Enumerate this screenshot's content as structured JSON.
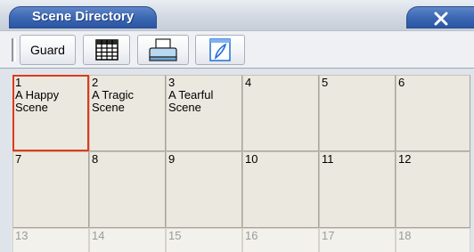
{
  "window": {
    "title": "Scene Directory",
    "accent_color": "#3c68b4",
    "selection_color": "#e03a17"
  },
  "toolbar": {
    "guard_label": "Guard",
    "buttons": [
      {
        "name": "guard-button",
        "label": "Guard"
      },
      {
        "name": "grid-view-button",
        "icon": "table-grid-icon"
      },
      {
        "name": "print-button",
        "icon": "printer-icon"
      },
      {
        "name": "edit-button",
        "icon": "document-edit-icon"
      }
    ]
  },
  "scenes": [
    {
      "number": "1",
      "name": "A Happy Scene",
      "selected": true
    },
    {
      "number": "2",
      "name": "A Tragic Scene"
    },
    {
      "number": "3",
      "name": "A Tearful Scene"
    },
    {
      "number": "4",
      "name": ""
    },
    {
      "number": "5",
      "name": ""
    },
    {
      "number": "6",
      "name": ""
    },
    {
      "number": "7",
      "name": ""
    },
    {
      "number": "8",
      "name": ""
    },
    {
      "number": "9",
      "name": ""
    },
    {
      "number": "10",
      "name": ""
    },
    {
      "number": "11",
      "name": ""
    },
    {
      "number": "12",
      "name": ""
    },
    {
      "number": "13",
      "name": "",
      "dim": true
    },
    {
      "number": "14",
      "name": "",
      "dim": true
    },
    {
      "number": "15",
      "name": "",
      "dim": true
    },
    {
      "number": "16",
      "name": "",
      "dim": true
    },
    {
      "number": "17",
      "name": "",
      "dim": true
    },
    {
      "number": "18",
      "name": "",
      "dim": true
    }
  ]
}
